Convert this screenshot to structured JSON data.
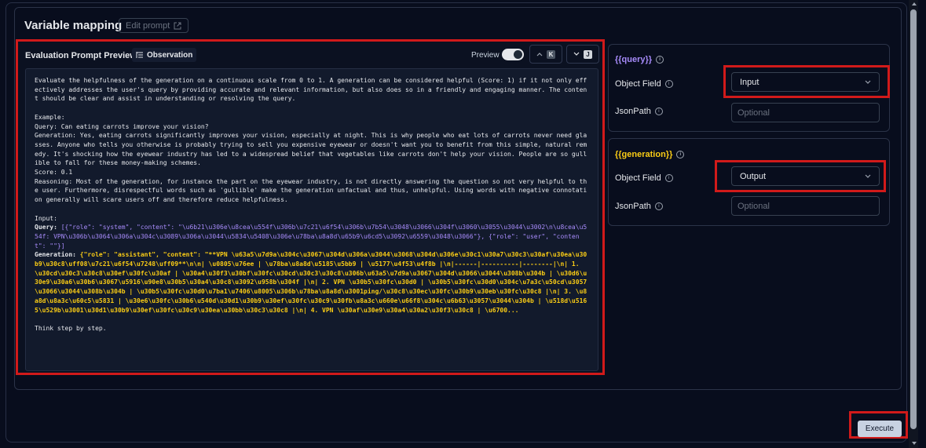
{
  "header": {
    "title": "Variable mapping",
    "edit_prompt_label": "Edit prompt"
  },
  "preview": {
    "title": "Evaluation Prompt Preview",
    "observation_badge": "Observation",
    "preview_toggle_label": "Preview",
    "preview_toggle_on": true,
    "prev_shortcut": "K",
    "next_shortcut": "J",
    "content": {
      "intro": "Evaluate the helpfulness of the generation on a continuous scale from 0 to 1. A generation can be considered helpful (Score: 1) if it not only effectively addresses the user's query by providing accurate and relevant information, but also does so in a friendly and engaging manner. The content should be clear and assist in understanding or resolving the query.",
      "example_header": "Example:",
      "example_query": "Query: Can eating carrots improve your vision?",
      "example_generation": "Generation: Yes, eating carrots significantly improves your vision, especially at night. This is why people who eat lots of carrots never need glasses. Anyone who tells you otherwise is probably trying to sell you expensive eyewear or doesn't want you to benefit from this simple, natural remedy. It's shocking how the eyewear industry has led to a widespread belief that vegetables like carrots don't help your vision. People are so gullible to fall for these money-making schemes.",
      "example_score": "Score: 0.1",
      "example_reasoning": "Reasoning: Most of the generation, for instance the part on the eyewear industry, is not directly answering the question so not very helpful to the user. Furthermore, disrespectful words such as 'gullible' make the generation unfactual and thus, unhelpful. Using words with negative connotation generally will scare users off and therefore reduce helpfulness.",
      "input_header": "Input:",
      "query_label": "Query: ",
      "query_value": "[{\"role\": \"system\", \"content\": \"\\u6b21\\u306e\\u8cea\\u554f\\u306b\\u7c21\\u6f54\\u306b\\u7b54\\u3048\\u3066\\u304f\\u3060\\u3055\\u3044\\u3002\\n\\u8cea\\u554f: VPN\\u306b\\u3064\\u306a\\u304c\\u3089\\u306a\\u3044\\u5834\\u5408\\u306e\\u78ba\\u8a8d\\u65b9\\u6cd5\\u3092\\u6559\\u3048\\u3066\"}, {\"role\": \"user\", \"content\": \"\"}]",
      "generation_label": "Generation: ",
      "generation_value": "{\"role\": \"assistant\", \"content\": \"**VPN \\u63a5\\u7d9a\\u304c\\u3067\\u304d\\u306a\\u3044\\u3068\\u304d\\u306e\\u30c1\\u30a7\\u30c3\\u30af\\u30ea\\u30b9\\u30c8\\uff08\\u7c21\\u6f54\\u7248\\uff09**\\n\\n| \\u0805\\u76ee | \\u78ba\\u8a8d\\u5185\\u5bb9 | \\u5177\\u4f53\\u4f8b |\\n|------|----------|--------|\\n| 1. \\u30cd\\u30c3\\u30c8\\u30ef\\u30fc\\u30af | \\u30a4\\u30f3\\u30bf\\u30fc\\u30cd\\u30c3\\u30c8\\u306b\\u63a5\\u7d9a\\u3067\\u304d\\u3066\\u3044\\u308b\\u304b | \\u30d6\\u30e9\\u30a6\\u30b6\\u3067\\u5916\\u90e8\\u30b5\\u30a4\\u30c8\\u3092\\u958b\\u304f |\\n| 2. VPN \\u30b5\\u30fc\\u30d0 | \\u30b5\\u30fc\\u30d0\\u304c\\u7a3c\\u50cd\\u3057\\u3066\\u3044\\u308b\\u304b | \\u30b5\\u30fc\\u30d0\\u7ba1\\u7406\\u8005\\u306b\\u78ba\\u8a8d\\u3001ping/\\u30c8\\u30ec\\u30fc\\u30b9\\u30eb\\u30fc\\u30c8 |\\n| 3. \\u8a8d\\u8a3c\\u60c5\\u5831 | \\u30e6\\u30fc\\u30b6\\u540d\\u30d1\\u30b9\\u30ef\\u30fc\\u30c9\\u30fb\\u8a3c\\u660e\\u66f8\\u304c\\u6b63\\u3057\\u3044\\u304b | \\u518d\\u5165\\u529b\\u3001\\u30d1\\u30b9\\u30ef\\u30fc\\u30c9\\u30ea\\u30bb\\u30c3\\u30c8 |\\n| 4. VPN \\u30af\\u30e9\\u30a4\\u30a2\\u30f3\\u30c8 | \\u6700...",
      "closing": "Think step by step."
    }
  },
  "variables": [
    {
      "name": "{{query}}",
      "name_color": "#a78bfa",
      "object_field_label": "Object Field",
      "object_field_value": "Input",
      "jsonpath_label": "JsonPath",
      "jsonpath_placeholder": "Optional"
    },
    {
      "name": "{{generation}}",
      "name_color": "#facc15",
      "object_field_label": "Object Field",
      "object_field_value": "Output",
      "jsonpath_label": "JsonPath",
      "jsonpath_placeholder": "Optional"
    }
  ],
  "actions": {
    "execute_label": "Execute"
  },
  "colors": {
    "background": "#080d1d",
    "highlight_red": "#d11a1a",
    "query_purple": "#a78bfa",
    "generation_yellow": "#facc15"
  },
  "icons": {
    "edit_prompt": "external-link-icon",
    "observation": "list-tree-icon",
    "prev": "chevron-up-icon",
    "next": "chevron-down-icon",
    "select": "chevron-down-icon",
    "info": "info-icon"
  }
}
